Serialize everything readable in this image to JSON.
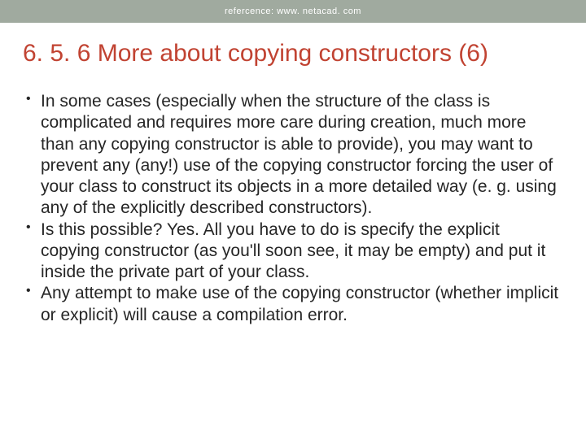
{
  "header": {
    "reference": "refercence: www. netacad. com"
  },
  "slide": {
    "title": "6. 5. 6 More about copying constructors (6)",
    "bullets": [
      "In some cases (especially when the structure of the class is complicated and requires more care during creation, much more than any copying constructor is able to provide), you may want to prevent any (any!) use of the copying constructor forcing the user of your class to construct its objects in a more detailed way (e. g. using any of the explicitly described constructors).",
      "Is this possible? Yes. All you have to do is specify the explicit copying constructor (as you'll soon see, it may be empty) and put it inside the private part of your class.",
      "Any attempt to make use of the copying constructor (whether implicit or explicit) will cause a compilation error."
    ]
  }
}
